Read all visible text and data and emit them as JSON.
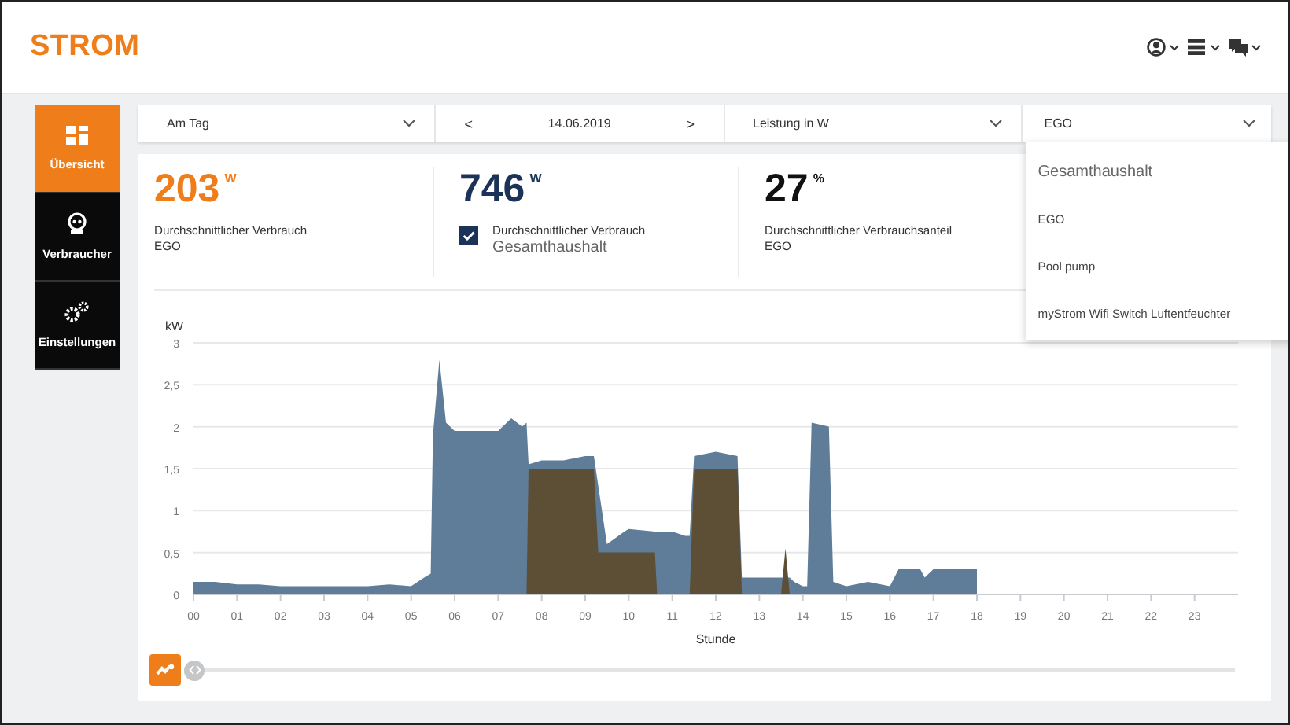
{
  "header": {
    "logo": "STROM"
  },
  "sidebar": {
    "items": [
      {
        "label": "Übersicht",
        "selected": true
      },
      {
        "label": "Verbraucher",
        "selected": false
      },
      {
        "label": "Einstellungen",
        "selected": false
      }
    ]
  },
  "toolbar": {
    "period": {
      "value": "Am Tag"
    },
    "date_nav": {
      "prev": "<",
      "date": "14.06.2019",
      "next": ">"
    },
    "unit": {
      "value": "Leistung in W"
    },
    "device": {
      "value": "EGO",
      "expanded": true,
      "options": [
        {
          "label": "Gesamthaushalt",
          "kind": "group"
        },
        {
          "label": "EGO",
          "kind": "option"
        },
        {
          "label": "Pool pump",
          "kind": "option"
        },
        {
          "label": "myStrom Wifi Switch Luftentfeuchter",
          "kind": "option"
        }
      ]
    }
  },
  "stats": [
    {
      "value": "203",
      "unit": "W",
      "label": "Durchschnittlicher Verbrauch",
      "sub": "EGO",
      "kind": "accent"
    },
    {
      "value": "746",
      "unit": "W",
      "label": "Durchschnittlicher Verbrauch",
      "sub": "Gesamthaushalt",
      "kind": "total",
      "checked": true
    },
    {
      "value": "27",
      "unit": "%",
      "label": "Durchschnittlicher Verbrauchsanteil",
      "sub": "EGO",
      "kind": "plain"
    }
  ],
  "chart": {
    "chart_data": {
      "type": "area",
      "xlabel": "Stunde",
      "ylabel": "kW",
      "x": [
        0,
        0.5,
        1,
        1.5,
        2,
        2.5,
        3,
        3.5,
        4,
        4.5,
        5,
        5.3,
        5.45,
        5.5,
        5.65,
        5.8,
        6,
        6.5,
        7,
        7.3,
        7.55,
        7.65,
        7.7,
        8,
        8.5,
        9,
        9.2,
        9.3,
        9.5,
        9.9,
        10,
        10.6,
        10.65,
        11,
        11.3,
        11.4,
        11.5,
        12,
        12.5,
        12.6,
        12.7,
        13,
        13.5,
        13.6,
        13.7,
        13.8,
        14,
        14.1,
        14.2,
        14.6,
        14.7,
        15,
        15.5,
        16,
        16.2,
        16.5,
        16.7,
        16.8,
        17,
        18
      ],
      "series": [
        {
          "color": "#5f7d99",
          "values": [
            0.15,
            0.15,
            0.12,
            0.12,
            0.1,
            0.1,
            0.1,
            0.1,
            0.1,
            0.12,
            0.1,
            0.2,
            0.25,
            1.9,
            2.8,
            2.05,
            1.95,
            1.95,
            1.95,
            2.1,
            2.0,
            2.05,
            1.55,
            1.6,
            1.6,
            1.65,
            1.65,
            null,
            0.6,
            0.75,
            0.78,
            0.75,
            0.75,
            0.75,
            0.7,
            0.7,
            1.65,
            1.7,
            1.65,
            0.2,
            0.2,
            0.2,
            0.2,
            null,
            0.2,
            0.15,
            0.1,
            0.1,
            2.05,
            2.0,
            0.15,
            0.1,
            0.15,
            0.1,
            0.3,
            0.3,
            0.3,
            0.2,
            0.3,
            0.3
          ]
        },
        {
          "color": "#5c4f36",
          "values": [
            0,
            0,
            0,
            0,
            0,
            0,
            0,
            0,
            0,
            0,
            0,
            0,
            0,
            0,
            0,
            0,
            0,
            0,
            0,
            0,
            0,
            0,
            1.5,
            1.5,
            1.5,
            1.5,
            1.5,
            0.5,
            0.5,
            0.5,
            0.5,
            0.5,
            0,
            0,
            0,
            0,
            1.5,
            1.5,
            1.5,
            0,
            0,
            0,
            0,
            0.55,
            0,
            0,
            0,
            0,
            0,
            0,
            0,
            0,
            0,
            0,
            0,
            0,
            0,
            0,
            0,
            0
          ]
        }
      ],
      "xlim": [
        0,
        24
      ],
      "ylim": [
        0,
        3
      ],
      "grid": true,
      "xticks": [
        {
          "value": 0,
          "label": "00"
        },
        {
          "value": 1,
          "label": "01"
        },
        {
          "value": 2,
          "label": "02"
        },
        {
          "value": 3,
          "label": "03"
        },
        {
          "value": 4,
          "label": "04"
        },
        {
          "value": 5,
          "label": "05"
        },
        {
          "value": 6,
          "label": "06"
        },
        {
          "value": 7,
          "label": "07"
        },
        {
          "value": 8,
          "label": "08"
        },
        {
          "value": 9,
          "label": "09"
        },
        {
          "value": 10,
          "label": "10"
        },
        {
          "value": 11,
          "label": "11"
        },
        {
          "value": 12,
          "label": "12"
        },
        {
          "value": 13,
          "label": "13"
        },
        {
          "value": 14,
          "label": "14"
        },
        {
          "value": 15,
          "label": "15"
        },
        {
          "value": 16,
          "label": "16"
        },
        {
          "value": 17,
          "label": "17"
        },
        {
          "value": 18,
          "label": "18"
        },
        {
          "value": 19,
          "label": "19"
        },
        {
          "value": 20,
          "label": "20"
        },
        {
          "value": 21,
          "label": "21"
        },
        {
          "value": 22,
          "label": "22"
        },
        {
          "value": 23,
          "label": "23"
        }
      ],
      "yticks": [
        {
          "value": 0,
          "label": "0"
        },
        {
          "value": 0.5,
          "label": "0,5"
        },
        {
          "value": 1,
          "label": "1"
        },
        {
          "value": 1.5,
          "label": "1,5"
        },
        {
          "value": 2,
          "label": "2"
        },
        {
          "value": 2.5,
          "label": "2,5"
        },
        {
          "value": 3,
          "label": "3"
        }
      ]
    }
  }
}
